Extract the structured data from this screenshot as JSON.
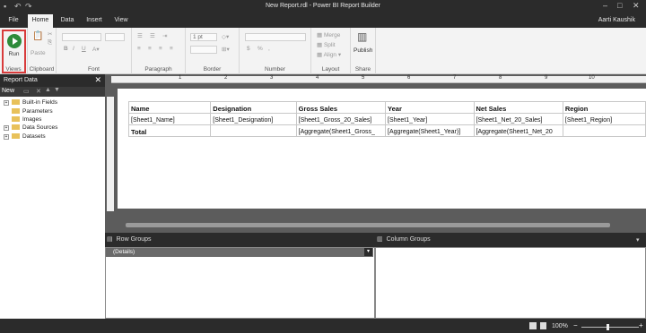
{
  "window": {
    "title": "New Report.rdl - Power BI Report Builder",
    "user": "Aarti Kaushik"
  },
  "tabs": [
    "File",
    "Home",
    "Data",
    "Insert",
    "View"
  ],
  "ribbon": {
    "run": "Run",
    "paste": "Paste",
    "font_size": "1 pt",
    "merge": "Merge",
    "split": "Split",
    "align": "Align",
    "publish": "Publish",
    "groups": [
      "Views",
      "Clipboard",
      "Font",
      "Paragraph",
      "Border",
      "Number",
      "Layout",
      "Share"
    ]
  },
  "report_data": {
    "title": "Report Data",
    "new_label": "New",
    "items": [
      "Built-in Fields",
      "Parameters",
      "Images",
      "Data Sources",
      "Datasets"
    ]
  },
  "ruler_marks": [
    "1",
    "2",
    "3",
    "4",
    "5",
    "6",
    "7",
    "8",
    "9",
    "10"
  ],
  "tablix": {
    "headers": [
      "Name",
      "Designation",
      "Gross Sales",
      "Year",
      "Net Sales",
      "Region"
    ],
    "detail": [
      "[Sheet1_Name]",
      "[Sheet1_Designation]",
      "[Sheet1_Gross_20_Sales]",
      "[Sheet1_Year]",
      "[Sheet1_Net_20_Sales]",
      "[Sheet1_Region]"
    ],
    "total": [
      "Total",
      "",
      "[Aggregate(Sheet1_Gross_",
      "[Aggregate(Sheet1_Year)]",
      "[Aggregate(Sheet1_Net_20",
      ""
    ]
  },
  "groups": {
    "row_title": "Row Groups",
    "column_title": "Column Groups",
    "details": "(Details)"
  },
  "status": {
    "zoom": "100%"
  }
}
